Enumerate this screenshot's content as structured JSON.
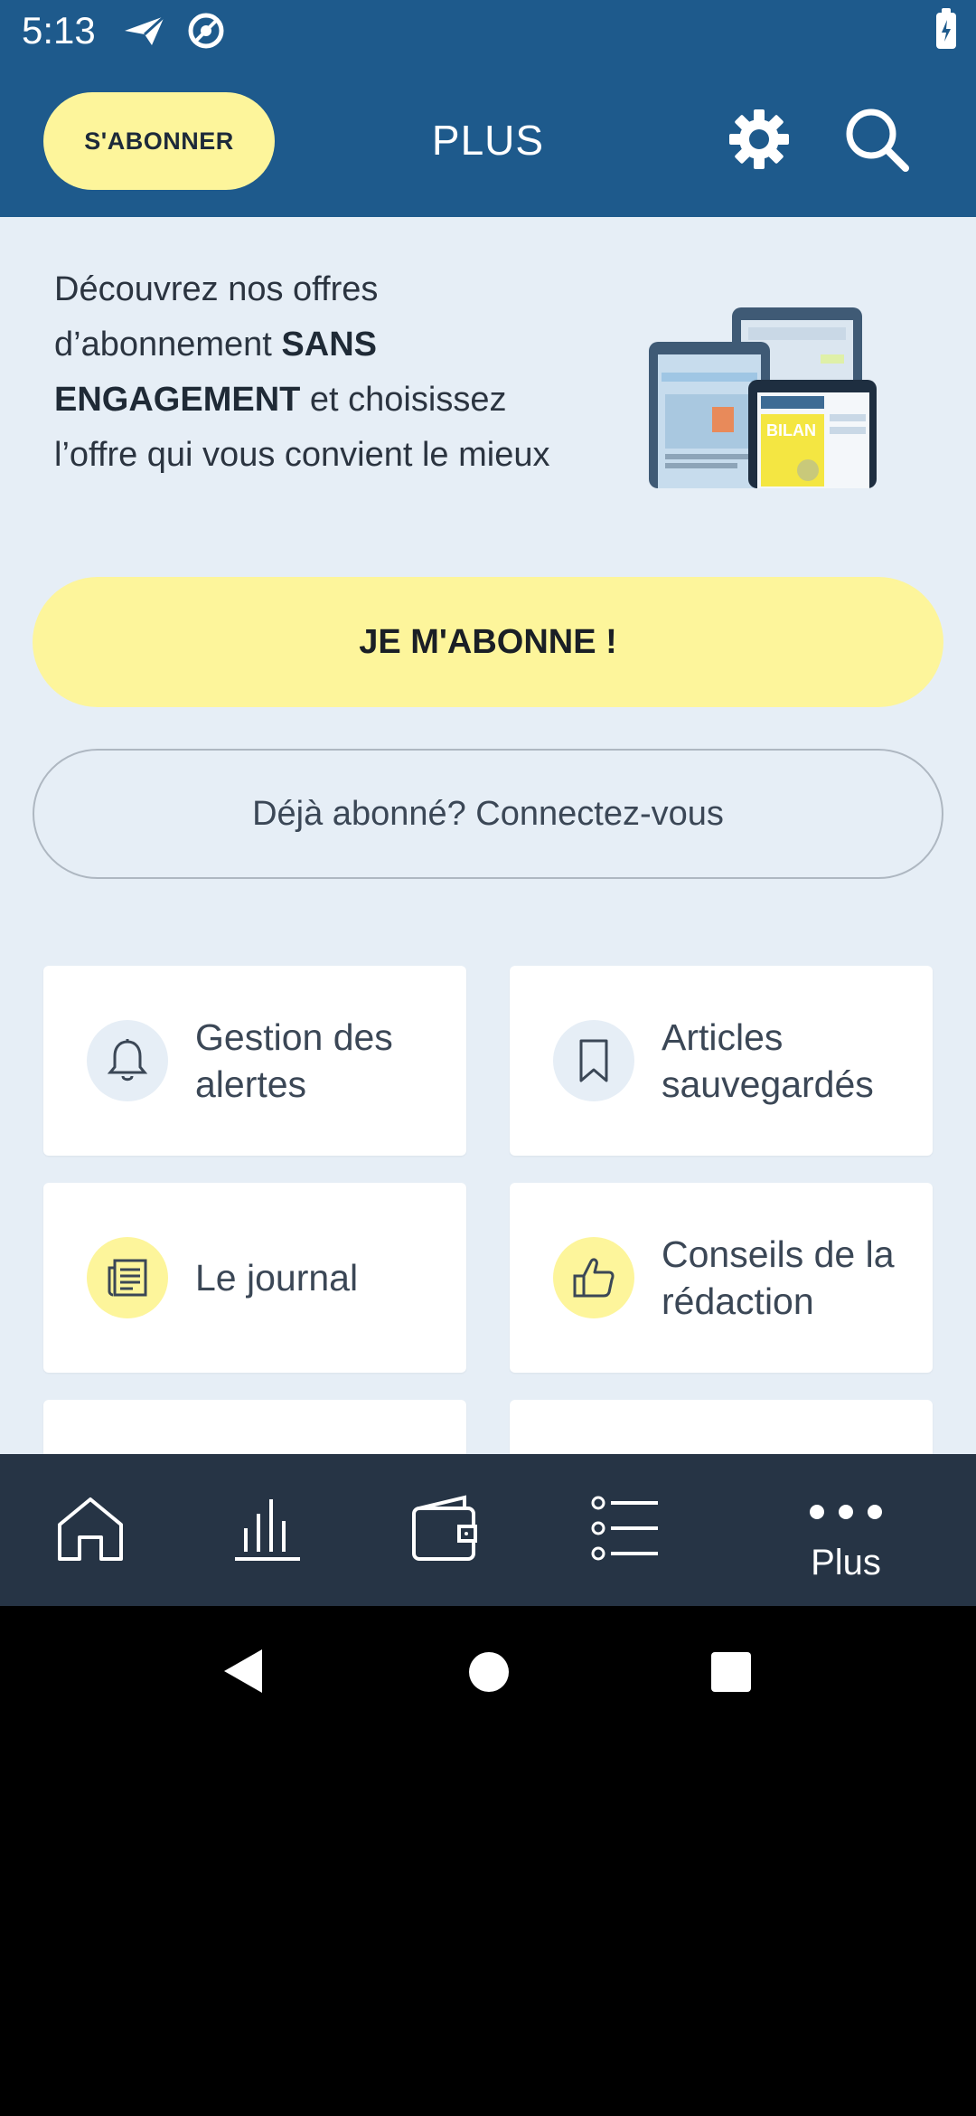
{
  "status_bar": {
    "time": "5:13"
  },
  "header": {
    "subscribe_label": "S'ABONNER",
    "title": "PLUS"
  },
  "promo": {
    "line1": "Découvrez nos offres d’abonnement ",
    "bold1": "SANS ENGAGEMENT",
    "line2": " et choisissez l’offre qui vous convient le mieux"
  },
  "cta": {
    "primary": "JE M'ABONNE !",
    "secondary": "Déjà abonné? Connectez-vous"
  },
  "tiles": [
    {
      "label": "Gestion des alertes",
      "icon": "bell-icon"
    },
    {
      "label": "Articles sauvegardés",
      "icon": "bookmark-icon"
    },
    {
      "label": "Le journal",
      "icon": "newspaper-icon"
    },
    {
      "label": "Conseils de la rédaction",
      "icon": "thumbs-up-icon"
    }
  ],
  "bottom_nav": {
    "items": [
      "home-icon",
      "chart-icon",
      "wallet-icon",
      "list-icon",
      "more-icon"
    ],
    "plus_label": "Plus"
  },
  "colors": {
    "brand_blue": "#1e5a8c",
    "accent_yellow": "#fdf59b",
    "content_bg": "#e6eef6",
    "nav_bg": "#263445"
  }
}
